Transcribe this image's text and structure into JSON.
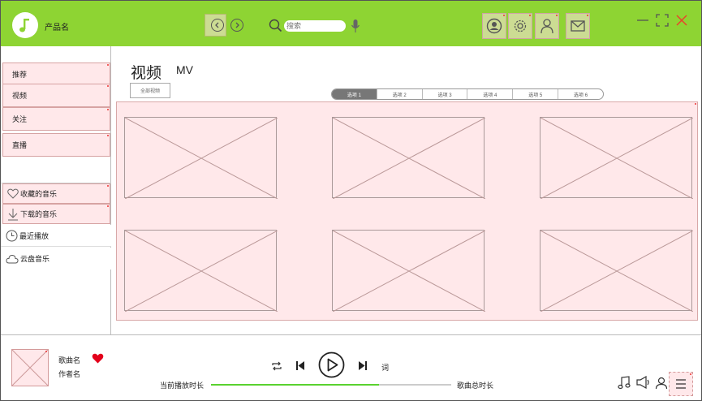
{
  "header": {
    "app_name": "产品名",
    "search_placeholder": "搜索",
    "accent_color": "#8ed433"
  },
  "sidebar": {
    "items": [
      {
        "label": "推荐"
      },
      {
        "label": "视频"
      },
      {
        "label": "关注"
      },
      {
        "label": "直播"
      }
    ],
    "library": [
      {
        "label": "收藏的音乐",
        "icon": "heart-icon"
      },
      {
        "label": "下载的音乐",
        "icon": "download-icon"
      },
      {
        "label": "最近播放",
        "icon": "clock-icon"
      },
      {
        "label": "云盘音乐",
        "icon": "cloud-icon"
      }
    ]
  },
  "main": {
    "title": "视频",
    "secondary_tab": "MV",
    "all_button": "全部视频",
    "filter_tabs": [
      "选项 1",
      "选项 2",
      "选项 3",
      "选项 4",
      "选项 5",
      "选项 6"
    ],
    "active_tab": "选项 1"
  },
  "player": {
    "song_name": "歌曲名",
    "artist_name": "作者名",
    "lyric_label": "词",
    "current_time": "当前播放时长",
    "total_time": "歌曲总时长",
    "progress": 0.7,
    "progress_color": "#5ad22f",
    "heart_color": "#e3001b"
  }
}
